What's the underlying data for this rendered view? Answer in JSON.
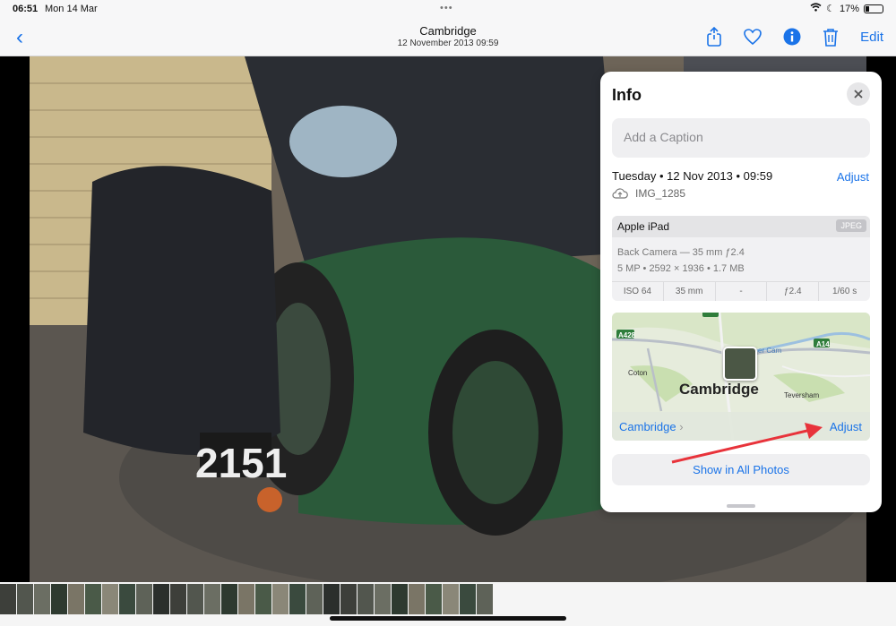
{
  "status": {
    "time": "06:51",
    "date": "Mon 14 Mar",
    "battery": "17%"
  },
  "nav": {
    "title": "Cambridge",
    "subtitle": "12 November 2013  09:59",
    "edit_label": "Edit"
  },
  "info": {
    "title": "Info",
    "caption_placeholder": "Add a Caption",
    "date": "Tuesday • 12 Nov 2013 • 09:59",
    "adjust_label": "Adjust",
    "filename": "IMG_1285",
    "camera": {
      "device": "Apple iPad",
      "format": "JPEG",
      "lens": "Back Camera — 35 mm ƒ2.4",
      "details": "5 MP • 2592 × 1936 • 1.7 MB",
      "specs": [
        "ISO 64",
        "35 mm",
        "-",
        "ƒ2.4",
        "1/60 s"
      ]
    },
    "map": {
      "city": "Cambridge",
      "labels": {
        "a428": "A428",
        "a14": "A14",
        "coton": "Coton",
        "teversham": "Teversham",
        "cam": "er Cam"
      },
      "place_link": "Cambridge",
      "adjust_label": "Adjust"
    },
    "show_all": "Show in All Photos"
  },
  "colors": {
    "accent": "#1a73e8",
    "car_green": "#2b5a3a",
    "annotation": "#e8333b"
  }
}
